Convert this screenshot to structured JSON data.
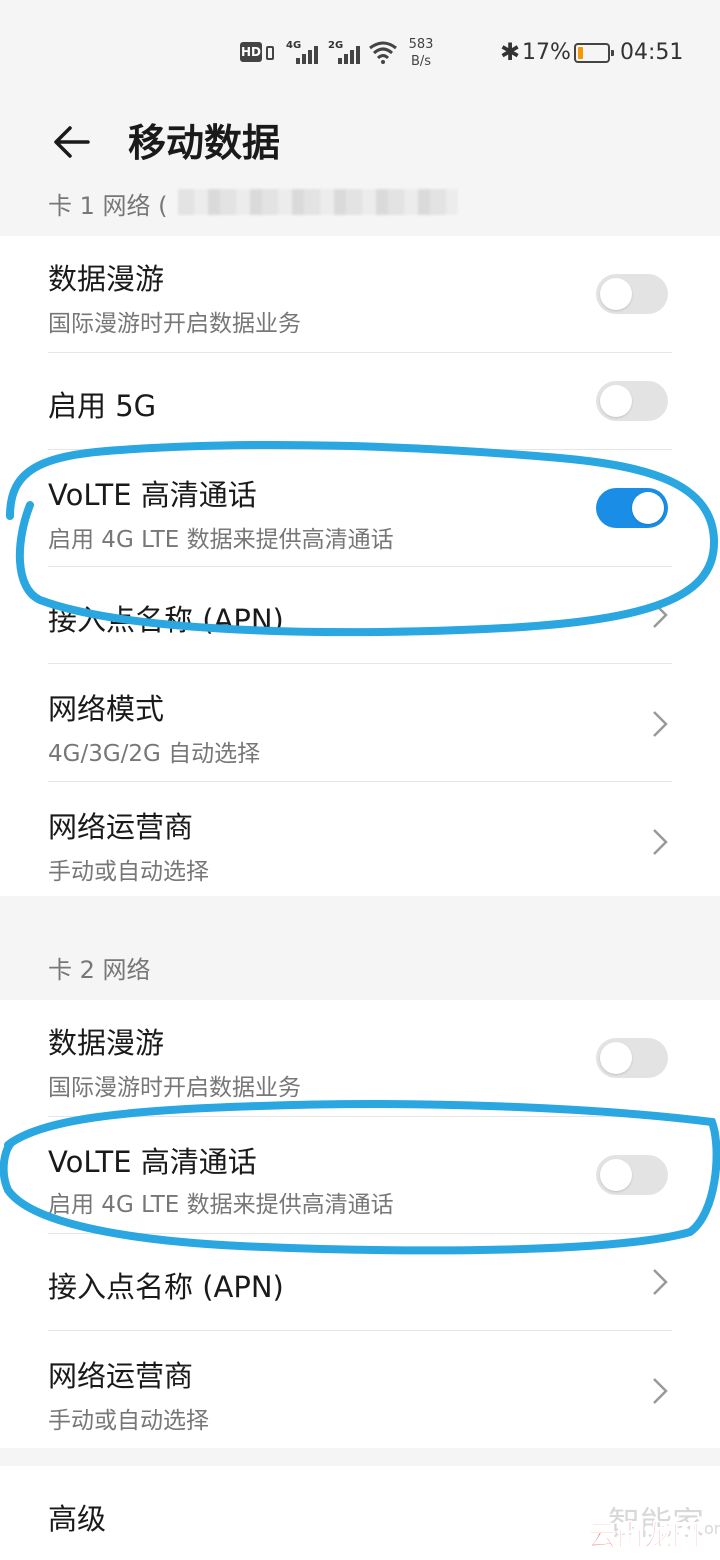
{
  "status_bar": {
    "hd_label": "HD",
    "sim1_gen": "4G",
    "sim2_gen": "2G",
    "net_speed_value": "583",
    "net_speed_unit": "B/s",
    "battery_percent": "17%",
    "battery_level": 0.17,
    "time": "04:51",
    "icons": [
      "hd-icon",
      "signal-icon",
      "wifi-icon",
      "bluetooth-icon",
      "battery-icon"
    ]
  },
  "header": {
    "title": "移动数据",
    "back_icon": "arrow-left-icon"
  },
  "sim1": {
    "label": "卡 1 网络 (",
    "items": [
      {
        "title": "数据漫游",
        "subtitle": "国际漫游时开启数据业务",
        "toggle": false
      },
      {
        "title": "启用 5G",
        "toggle": false
      },
      {
        "title": "VoLTE 高清通话",
        "subtitle": "启用 4G LTE 数据来提供高清通话",
        "toggle": true
      },
      {
        "title": "接入点名称 (APN)"
      },
      {
        "title": "网络模式",
        "subtitle": "4G/3G/2G 自动选择"
      },
      {
        "title": "网络运营商",
        "subtitle": "手动或自动选择"
      }
    ]
  },
  "sim2": {
    "label": "卡 2 网络",
    "items": [
      {
        "title": "数据漫游",
        "subtitle": "国际漫游时开启数据业务",
        "toggle": false
      },
      {
        "title": "VoLTE 高清通话",
        "subtitle": "启用 4G LTE 数据来提供高清通话",
        "toggle": false
      },
      {
        "title": "接入点名称 (APN)"
      },
      {
        "title": "网络运营商",
        "subtitle": "手动或自动选择"
      }
    ]
  },
  "advanced": {
    "title": "高级"
  },
  "colors": {
    "accent": "#1a8ee6",
    "annotation": "#2aa6e0",
    "battery": "#f39800"
  },
  "watermark": {
    "top": "智能家",
    "top_suffix": "om",
    "bottom": "云南龙网"
  }
}
